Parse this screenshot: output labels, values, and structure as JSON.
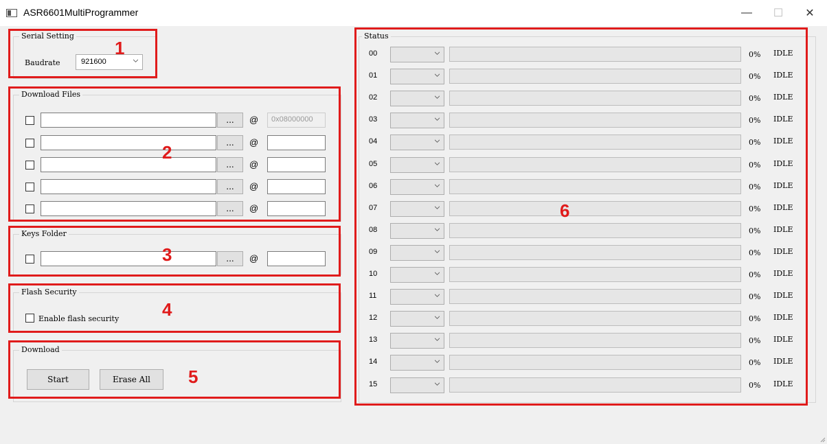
{
  "window": {
    "title": "ASR6601MultiProgrammer",
    "minimize_glyph": "—",
    "maximize_glyph": "☐",
    "close_glyph": "✕"
  },
  "serial": {
    "group_label": "Serial Setting",
    "baudrate_label": "Baudrate",
    "baudrate_value": "921600"
  },
  "download_files": {
    "group_label": "Download Files",
    "rows": [
      {
        "path": "",
        "browse": "...",
        "at": "@",
        "address": "0x08000000",
        "address_enabled": false
      },
      {
        "path": "",
        "browse": "...",
        "at": "@",
        "address": ""
      },
      {
        "path": "",
        "browse": "...",
        "at": "@",
        "address": ""
      },
      {
        "path": "",
        "browse": "...",
        "at": "@",
        "address": ""
      },
      {
        "path": "",
        "browse": "...",
        "at": "@",
        "address": ""
      }
    ]
  },
  "keys_folder": {
    "group_label": "Keys Folder",
    "path": "",
    "browse": "...",
    "at": "@",
    "address": ""
  },
  "flash_security": {
    "group_label": "Flash Security",
    "checkbox_label": "Enable flash security"
  },
  "download": {
    "group_label": "Download",
    "start_label": "Start",
    "erase_label": "Erase All"
  },
  "status": {
    "group_label": "Status",
    "rows": [
      {
        "index": "00",
        "percent": "0%",
        "state": "IDLE",
        "progress": 0
      },
      {
        "index": "01",
        "percent": "0%",
        "state": "IDLE",
        "progress": 0
      },
      {
        "index": "02",
        "percent": "0%",
        "state": "IDLE",
        "progress": 0
      },
      {
        "index": "03",
        "percent": "0%",
        "state": "IDLE",
        "progress": 0
      },
      {
        "index": "04",
        "percent": "0%",
        "state": "IDLE",
        "progress": 0
      },
      {
        "index": "05",
        "percent": "0%",
        "state": "IDLE",
        "progress": 0
      },
      {
        "index": "06",
        "percent": "0%",
        "state": "IDLE",
        "progress": 0
      },
      {
        "index": "07",
        "percent": "0%",
        "state": "IDLE",
        "progress": 0
      },
      {
        "index": "08",
        "percent": "0%",
        "state": "IDLE",
        "progress": 0
      },
      {
        "index": "09",
        "percent": "0%",
        "state": "IDLE",
        "progress": 0
      },
      {
        "index": "10",
        "percent": "0%",
        "state": "IDLE",
        "progress": 0
      },
      {
        "index": "11",
        "percent": "0%",
        "state": "IDLE",
        "progress": 0
      },
      {
        "index": "12",
        "percent": "0%",
        "state": "IDLE",
        "progress": 0
      },
      {
        "index": "13",
        "percent": "0%",
        "state": "IDLE",
        "progress": 0
      },
      {
        "index": "14",
        "percent": "0%",
        "state": "IDLE",
        "progress": 0
      },
      {
        "index": "15",
        "percent": "0%",
        "state": "IDLE",
        "progress": 0
      }
    ]
  },
  "annotations": {
    "n1": "1",
    "n2": "2",
    "n3": "3",
    "n4": "4",
    "n5": "5",
    "n6": "6",
    "color": "#e01b1b"
  }
}
